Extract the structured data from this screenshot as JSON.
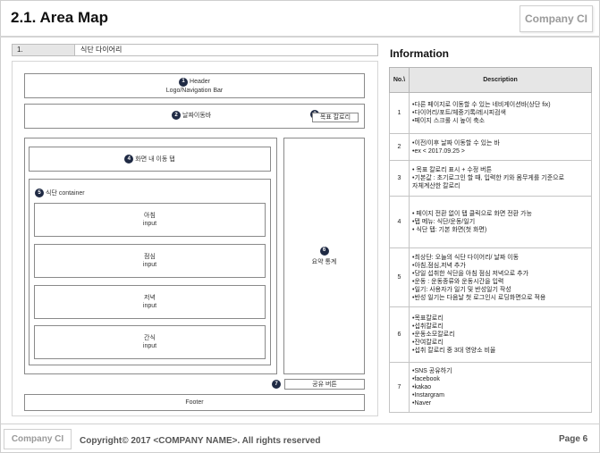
{
  "header": {
    "title": "2.1. Area Map",
    "company_ci": "Company CI"
  },
  "section": {
    "number": "1.",
    "name": "식단 다이어리"
  },
  "wireframe": {
    "header_line1": "Header",
    "header_line2": "Logo/Navigation Bar",
    "date_nav": "날짜이동바",
    "goal_calorie": "목표 칼로리",
    "screen_tab": "화면 내 이동 탭",
    "diet_container": "식단 container",
    "meals": [
      {
        "name": "아침",
        "sub": "input"
      },
      {
        "name": "점심",
        "sub": "input"
      },
      {
        "name": "저녁",
        "sub": "input"
      },
      {
        "name": "간식",
        "sub": "input"
      }
    ],
    "summary": "요약 통계",
    "share_button": "공유 버튼",
    "footer": "Footer",
    "markers": [
      "1",
      "2",
      "3",
      "4",
      "5",
      "6",
      "7"
    ]
  },
  "info": {
    "title": "Information",
    "col_no": "No.\\",
    "col_desc": "Description",
    "rows": [
      {
        "no": "1",
        "lines": [
          "•다른 페이지로 이동할 수 있는 네비게이션바(상단 fix)",
          "•다이어리/포트/체중기록/레시피검색",
          "•페이지 스크롤 시 높이 축소"
        ]
      },
      {
        "no": "2",
        "lines": [
          "•이전/이후 날짜 이동할 수 있는 바",
          "•ex < 2017.09.25 >"
        ]
      },
      {
        "no": "3",
        "lines": [
          "• 목표 칼로리 표시 + 수정 버튼",
          "•기본값 : 초기로그인 할 때, 입력한 키와 몸무게를 기준으로",
          "  자체계산한 칼로리"
        ]
      },
      {
        "no": "4",
        "lines": [
          "• 페이지 전환 없이 탭 클릭으로 화면 전환 가능",
          "•탭 메뉴: 식단/운동/일기",
          "• 식단 탭: 기본 화면(첫 화면)"
        ]
      },
      {
        "no": "5",
        "lines": [
          "•최상단: 오늘의 식단 다이어리/ 날짜 이동",
          "•아침,점심,저녁 추가",
          "•당일 섭취한 식단을 아침 점심 저녁으로 추가",
          "•운동 : 운동종류와 운동시간을 입력",
          "•일기: 사용자가 일기 및 반성일기 작성",
          "•반성 일기는 다음날 첫 로그인시 로딩화면으로 적용"
        ]
      },
      {
        "no": "6",
        "lines": [
          "•목표칼로리",
          "•섭취칼로리",
          "•운동소모칼로리",
          "•잔여칼로리",
          "•섭취 칼로리 중 3대 영양소 비율"
        ]
      },
      {
        "no": "7",
        "lines": [
          "•SNS 공유하기",
          "•facebook",
          "•kakao",
          "•Instargram",
          "•Naver"
        ]
      }
    ]
  },
  "footer": {
    "company_ci": "Company CI",
    "copyright": "Copyright© 2017 <COMPANY NAME>. All rights reserved",
    "page": "Page 6"
  }
}
